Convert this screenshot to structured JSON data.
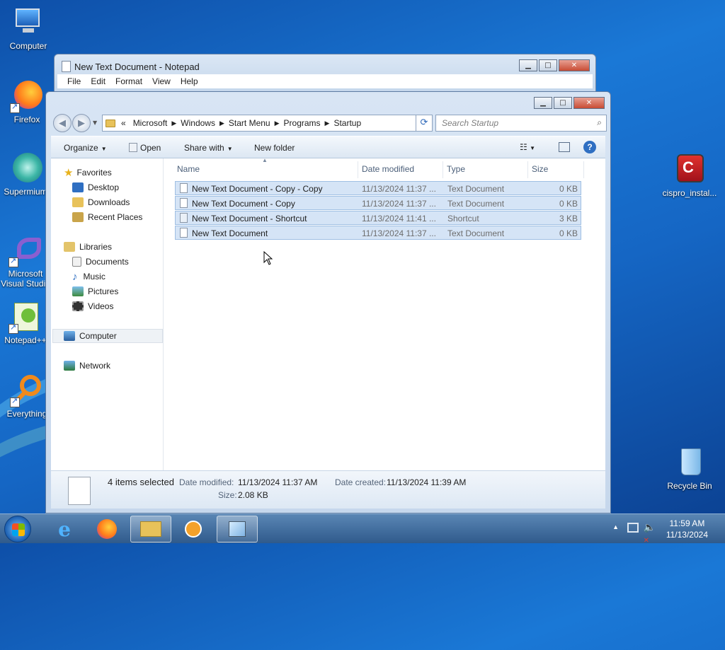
{
  "desktop": {
    "icons": [
      {
        "label": "Computer",
        "icon": "computer-icon"
      },
      {
        "label": "Firefox",
        "icon": "firefox-icon"
      },
      {
        "label": "Supermium",
        "icon": "supermium-icon"
      },
      {
        "label": "Microsoft Visual Studio",
        "icon": "visual-studio-icon"
      },
      {
        "label": "Notepad++",
        "icon": "notepadpp-icon"
      },
      {
        "label": "Everything",
        "icon": "everything-icon"
      },
      {
        "label": "cispro_instal...",
        "icon": "installer-icon"
      },
      {
        "label": "Recycle Bin",
        "icon": "recycle-bin-icon"
      }
    ]
  },
  "notepad": {
    "title": "New Text Document - Notepad",
    "menu": [
      "File",
      "Edit",
      "Format",
      "View",
      "Help"
    ]
  },
  "explorer": {
    "breadcrumb": {
      "overflow": "«",
      "items": [
        "Microsoft",
        "Windows",
        "Start Menu",
        "Programs",
        "Startup"
      ]
    },
    "search_placeholder": "Search Startup",
    "commands": {
      "organize": "Organize",
      "open": "Open",
      "share_with": "Share with",
      "new_folder": "New folder"
    },
    "nav": {
      "favorites": "Favorites",
      "desktop": "Desktop",
      "downloads": "Downloads",
      "recent_places": "Recent Places",
      "libraries": "Libraries",
      "documents": "Documents",
      "music": "Music",
      "pictures": "Pictures",
      "videos": "Videos",
      "computer": "Computer",
      "network": "Network"
    },
    "columns": {
      "name": "Name",
      "date_modified": "Date modified",
      "type": "Type",
      "size": "Size"
    },
    "files": [
      {
        "name": "New Text Document - Copy - Copy",
        "date": "11/13/2024 11:37 ...",
        "type": "Text Document",
        "size": "0 KB",
        "icon": "text-file-icon"
      },
      {
        "name": "New Text Document - Copy",
        "date": "11/13/2024 11:37 ...",
        "type": "Text Document",
        "size": "0 KB",
        "icon": "text-file-icon"
      },
      {
        "name": "New Text Document - Shortcut",
        "date": "11/13/2024 11:41 ...",
        "type": "Shortcut",
        "size": "3 KB",
        "icon": "shortcut-file-icon"
      },
      {
        "name": "New Text Document",
        "date": "11/13/2024 11:37 ...",
        "type": "Text Document",
        "size": "0 KB",
        "icon": "text-file-icon"
      }
    ],
    "details": {
      "selection": "4 items selected",
      "date_modified_label": "Date modified:",
      "date_modified_value": "11/13/2024 11:37 AM",
      "date_created_label": "Date created:",
      "date_created_value": "11/13/2024 11:39 AM",
      "size_label": "Size:",
      "size_value": "2.08 KB"
    }
  },
  "taskbar": {
    "time": "11:59 AM",
    "date": "11/13/2024"
  }
}
